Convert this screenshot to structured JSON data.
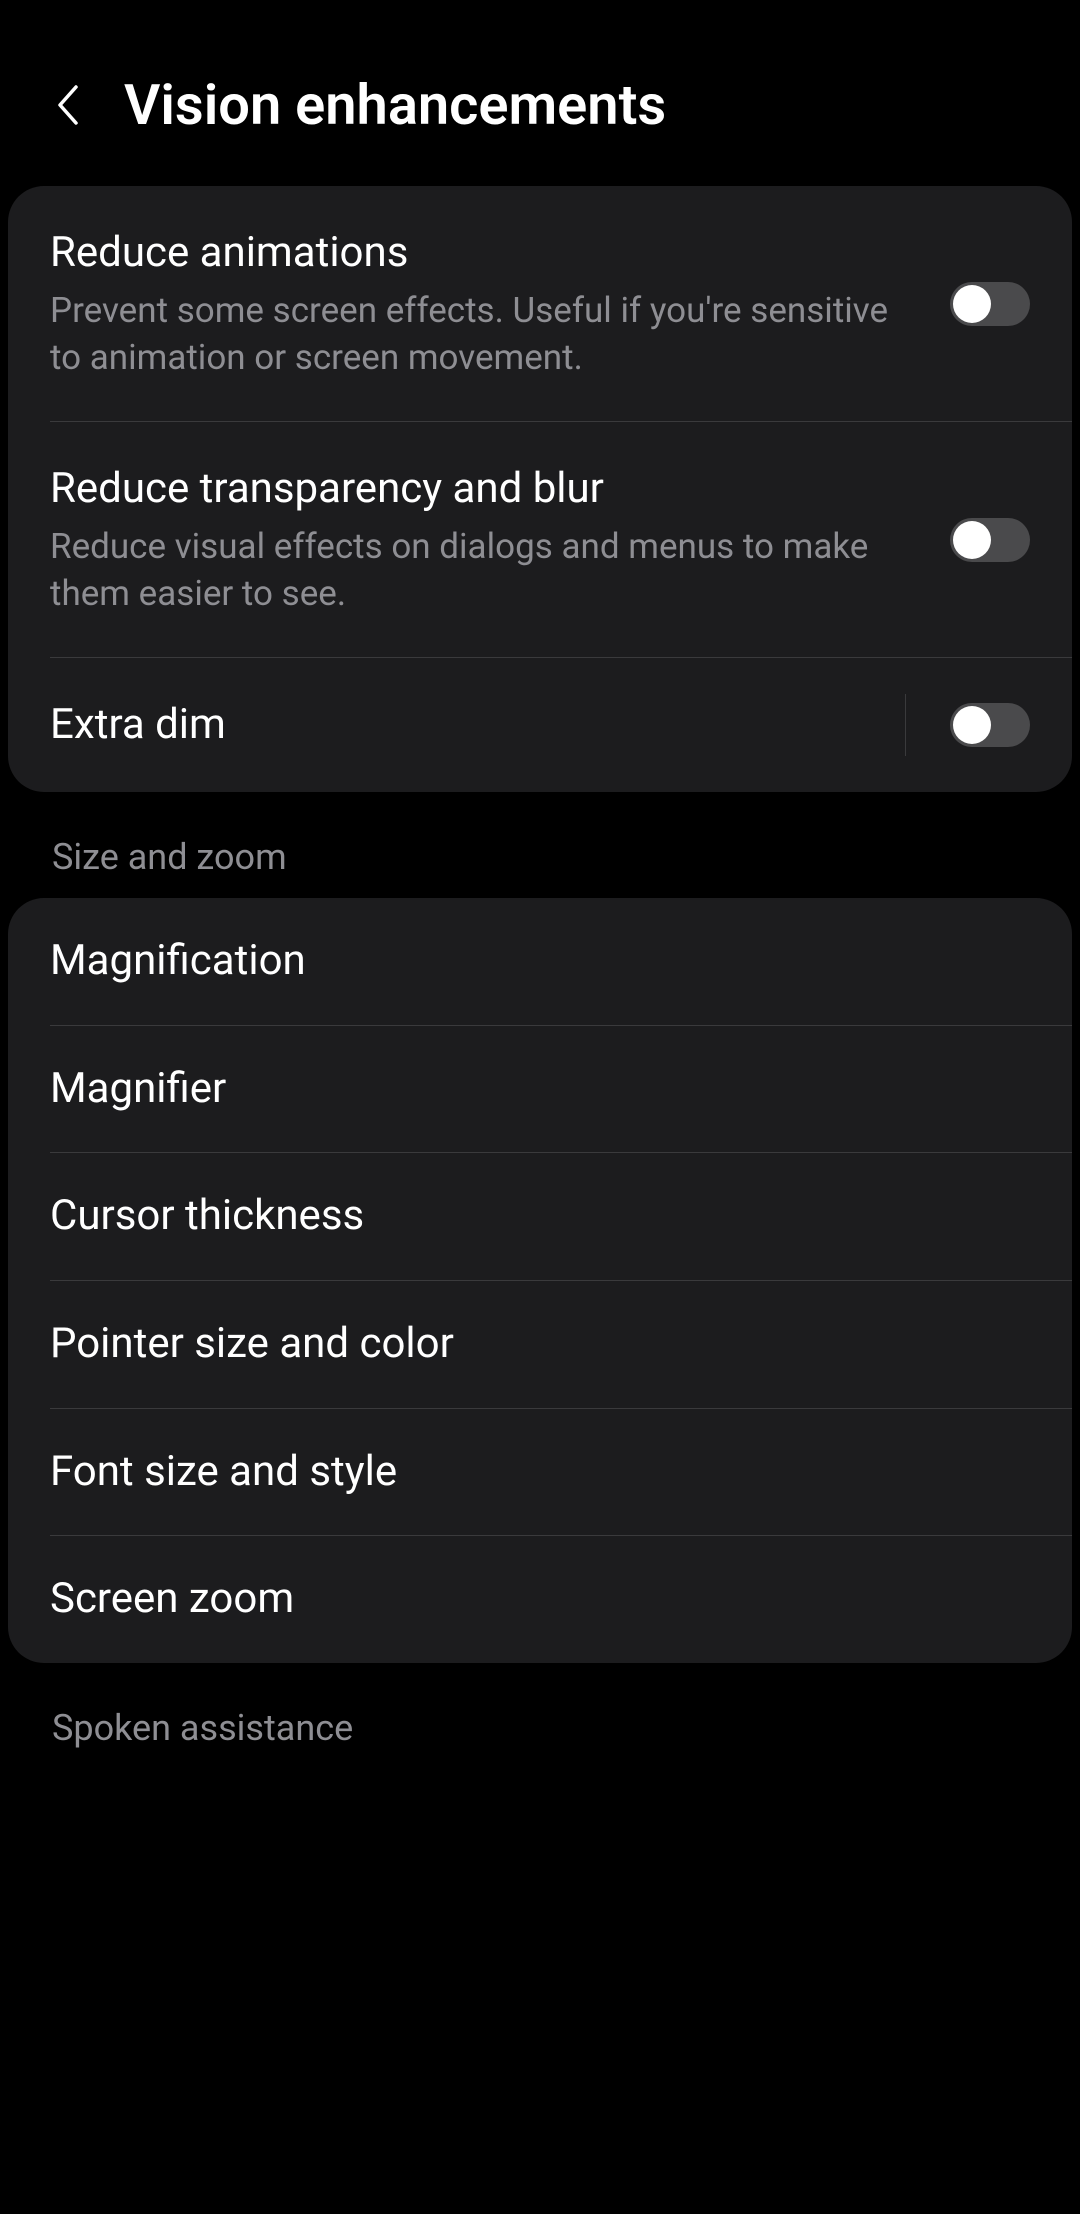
{
  "header": {
    "title": "Vision enhancements"
  },
  "group1": {
    "items": [
      {
        "title": "Reduce animations",
        "desc": "Prevent some screen effects. Useful if you're sensitive to animation or screen movement.",
        "toggle": false
      },
      {
        "title": "Reduce transparency and blur",
        "desc": "Reduce visual effects on dialogs and menus to make them easier to see.",
        "toggle": false
      },
      {
        "title": "Extra dim",
        "toggle": false
      }
    ]
  },
  "section2": {
    "label": "Size and zoom",
    "items": [
      {
        "title": "Magnification"
      },
      {
        "title": "Magnifier"
      },
      {
        "title": "Cursor thickness"
      },
      {
        "title": "Pointer size and color"
      },
      {
        "title": "Font size and style"
      },
      {
        "title": "Screen zoom"
      }
    ]
  },
  "section3": {
    "label": "Spoken assistance"
  }
}
